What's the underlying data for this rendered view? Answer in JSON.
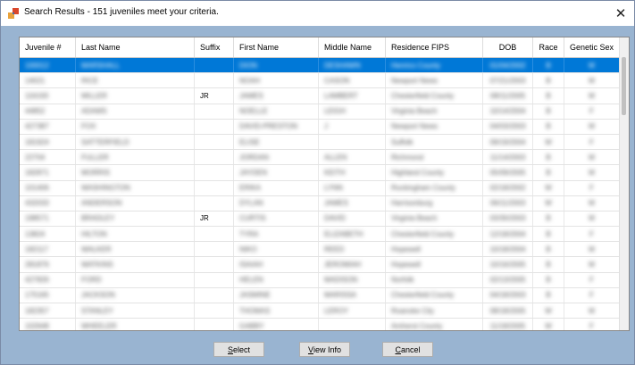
{
  "window": {
    "title": "Search Results - 151 juveniles meet your criteria.",
    "close_glyph": "✕",
    "app_icon": "app-icon"
  },
  "grid": {
    "columns": [
      "Juvenile #",
      "Last Name",
      "Suffix",
      "First Name",
      "Middle Name",
      "Residence FIPS",
      "DOB",
      "Race",
      "Genetic Sex"
    ],
    "rows": [
      [
        "100012",
        "MARSHALL",
        "",
        "DION",
        "DESHAWN",
        "Henrico County",
        "01/04/2002",
        "B",
        "M"
      ],
      [
        "14021",
        "RICE",
        "",
        "NOAH",
        "CASON",
        "Newport News",
        "07/21/2003",
        "B",
        "M"
      ],
      [
        "116193",
        "MILLER",
        "JR",
        "JAMES",
        "LAMBERT",
        "Chesterfield County",
        "08/11/2005",
        "B",
        "M"
      ],
      [
        "44852",
        "ADAMS",
        "",
        "NOELLE",
        "LEIGH",
        "Virginia Beach",
        "10/14/2004",
        "B",
        "F"
      ],
      [
        "427387",
        "FOX",
        "",
        "DAVID-PRESTON",
        "J",
        "Newport News",
        "04/03/2003",
        "B",
        "M"
      ],
      [
        "181924",
        "SATTERFIELD",
        "",
        "ELISE",
        "",
        "Suffolk",
        "09/19/2004",
        "W",
        "F"
      ],
      [
        "22704",
        "FULLER",
        "",
        "JORDAN",
        "ALLEN",
        "Richmond",
        "11/14/2003",
        "B",
        "M"
      ],
      [
        "182871",
        "MORRIS",
        "",
        "JAYDEN",
        "KEITH",
        "Highland County",
        "05/09/2005",
        "B",
        "M"
      ],
      [
        "101406",
        "WASHINGTON",
        "",
        "ERIKA",
        "LYNN",
        "Rockingham County",
        "02/18/2002",
        "W",
        "F"
      ],
      [
        "432033",
        "ANDERSON",
        "",
        "DYLAN",
        "JAMES",
        "Harrisonburg",
        "06/11/2003",
        "W",
        "M"
      ],
      [
        "198571",
        "BRADLEY",
        "JR",
        "CURTIS",
        "DAVID",
        "Virginia Beach",
        "03/30/2003",
        "B",
        "M"
      ],
      [
        "13824",
        "HILTON",
        "",
        "TYRA",
        "ELIZABETH",
        "Chesterfield County",
        "12/18/2004",
        "B",
        "F"
      ],
      [
        "182117",
        "WALKER",
        "",
        "NIKO",
        "REED",
        "Hopewell",
        "10/18/2004",
        "B",
        "M"
      ],
      [
        "281876",
        "WATKINS",
        "",
        "ISAIAH",
        "JEROMIAH",
        "Hopewell",
        "10/16/2005",
        "B",
        "M"
      ],
      [
        "427826",
        "FORD",
        "",
        "HELEN",
        "MADISON",
        "Norfolk",
        "02/13/2005",
        "B",
        "F"
      ],
      [
        "175165",
        "JACKSON",
        "",
        "JASMINE",
        "MARISSA",
        "Chesterfield County",
        "04/18/2003",
        "B",
        "F"
      ],
      [
        "182357",
        "STANLEY",
        "",
        "THOMAS",
        "LEROY",
        "Roanoke City",
        "08/18/2005",
        "W",
        "M"
      ],
      [
        "102648",
        "WHEELER",
        "",
        "GABBY",
        "",
        "Amherst County",
        "11/18/2005",
        "W",
        "F"
      ]
    ]
  },
  "buttons": {
    "select": {
      "accel": "S",
      "rest": "elect"
    },
    "view_info": {
      "accel": "V",
      "rest": "iew Info"
    },
    "cancel": {
      "accel": "C",
      "rest": "ancel"
    }
  },
  "colors": {
    "client_background": "#99b4d1",
    "selection": "#0078d7"
  }
}
